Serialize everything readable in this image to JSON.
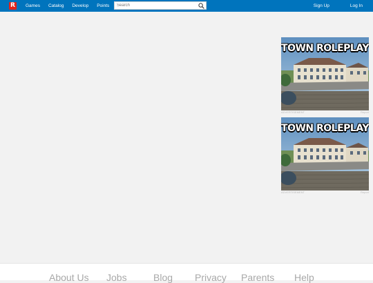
{
  "header": {
    "logo": "R",
    "nav": [
      "Games",
      "Catalog",
      "Develop",
      "Points"
    ],
    "search": {
      "placeholder": "Search"
    },
    "signup": "Sign Up",
    "login": "Log In"
  },
  "ads": [
    {
      "title": "TOWN ROLEPLAY",
      "left_meta": "ADVERTISEMENT",
      "right_meta": "Report"
    },
    {
      "title": "TOWN ROLEPLAY",
      "left_meta": "ADVERTISEMENT",
      "right_meta": "Report"
    }
  ],
  "footer": {
    "links": [
      "About Us",
      "Jobs",
      "Blog",
      "Privacy",
      "Parents",
      "Help"
    ]
  },
  "colors": {
    "topbar": "#0074bd",
    "background": "#f2f2f2",
    "logo": "#e2231a"
  }
}
